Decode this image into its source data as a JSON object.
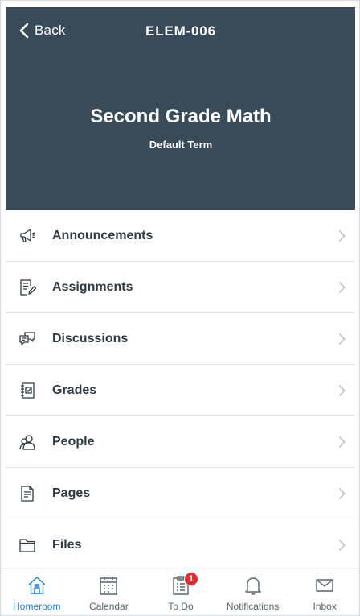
{
  "header": {
    "back_label": "Back",
    "course_code": "ELEM-006",
    "course_title": "Second Grade Math",
    "term": "Default Term",
    "bg_color": "#394b58"
  },
  "menu": {
    "items": [
      {
        "label": "Announcements",
        "icon": "megaphone-icon"
      },
      {
        "label": "Assignments",
        "icon": "assignment-icon"
      },
      {
        "label": "Discussions",
        "icon": "discussion-icon"
      },
      {
        "label": "Grades",
        "icon": "gradebook-icon"
      },
      {
        "label": "People",
        "icon": "people-icon"
      },
      {
        "label": "Pages",
        "icon": "document-icon"
      },
      {
        "label": "Files",
        "icon": "folder-icon"
      }
    ]
  },
  "tabbar": {
    "accent_color": "#1f7ad1",
    "tabs": [
      {
        "label": "Homeroom",
        "icon": "home-icon",
        "active": true
      },
      {
        "label": "Calendar",
        "icon": "calendar-icon"
      },
      {
        "label": "To Do",
        "icon": "todo-icon",
        "badge": "1"
      },
      {
        "label": "Notifications",
        "icon": "bell-icon"
      },
      {
        "label": "Inbox",
        "icon": "mail-icon"
      }
    ]
  }
}
